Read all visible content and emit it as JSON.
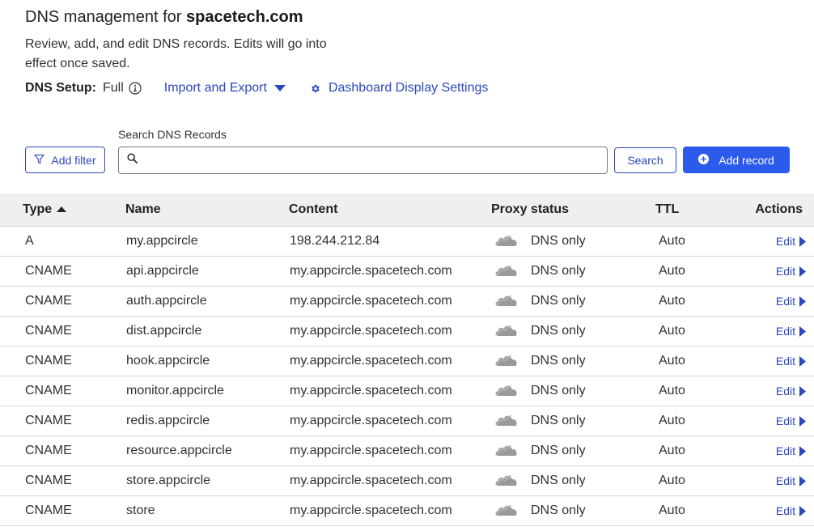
{
  "header": {
    "title_prefix": "DNS management for ",
    "domain": "spacetech.com",
    "description": "Review, add, and edit DNS records. Edits will go into effect once saved."
  },
  "setup": {
    "label": "DNS Setup:",
    "value": "Full",
    "info_icon": "info-circle-icon",
    "import_export_label": "Import and Export",
    "dashboard_settings_label": "Dashboard Display Settings"
  },
  "toolbar": {
    "add_filter_label": "Add filter",
    "search_label": "Search DNS Records",
    "search_value": "",
    "search_placeholder": "",
    "search_button_label": "Search",
    "add_record_label": "Add record",
    "accent_color": "#2c5aeb",
    "link_color": "#2c48bd"
  },
  "table": {
    "columns": [
      "Type",
      "Name",
      "Content",
      "Proxy status",
      "TTL",
      "Actions"
    ],
    "sorted_column": "Type",
    "sort_direction": "ascending",
    "rows": [
      {
        "type": "A",
        "name": "my.appcircle",
        "content": "198.244.212.84",
        "proxy": "DNS only",
        "ttl": "Auto",
        "action": "Edit"
      },
      {
        "type": "CNAME",
        "name": "api.appcircle",
        "content": "my.appcircle.spacetech.com",
        "proxy": "DNS only",
        "ttl": "Auto",
        "action": "Edit"
      },
      {
        "type": "CNAME",
        "name": "auth.appcircle",
        "content": "my.appcircle.spacetech.com",
        "proxy": "DNS only",
        "ttl": "Auto",
        "action": "Edit"
      },
      {
        "type": "CNAME",
        "name": "dist.appcircle",
        "content": "my.appcircle.spacetech.com",
        "proxy": "DNS only",
        "ttl": "Auto",
        "action": "Edit"
      },
      {
        "type": "CNAME",
        "name": "hook.appcircle",
        "content": "my.appcircle.spacetech.com",
        "proxy": "DNS only",
        "ttl": "Auto",
        "action": "Edit"
      },
      {
        "type": "CNAME",
        "name": "monitor.appcircle",
        "content": "my.appcircle.spacetech.com",
        "proxy": "DNS only",
        "ttl": "Auto",
        "action": "Edit"
      },
      {
        "type": "CNAME",
        "name": "redis.appcircle",
        "content": "my.appcircle.spacetech.com",
        "proxy": "DNS only",
        "ttl": "Auto",
        "action": "Edit"
      },
      {
        "type": "CNAME",
        "name": "resource.appcircle",
        "content": "my.appcircle.spacetech.com",
        "proxy": "DNS only",
        "ttl": "Auto",
        "action": "Edit"
      },
      {
        "type": "CNAME",
        "name": "store.appcircle",
        "content": "my.appcircle.spacetech.com",
        "proxy": "DNS only",
        "ttl": "Auto",
        "action": "Edit"
      },
      {
        "type": "CNAME",
        "name": "store",
        "content": "my.appcircle.spacetech.com",
        "proxy": "DNS only",
        "ttl": "Auto",
        "action": "Edit"
      }
    ]
  }
}
